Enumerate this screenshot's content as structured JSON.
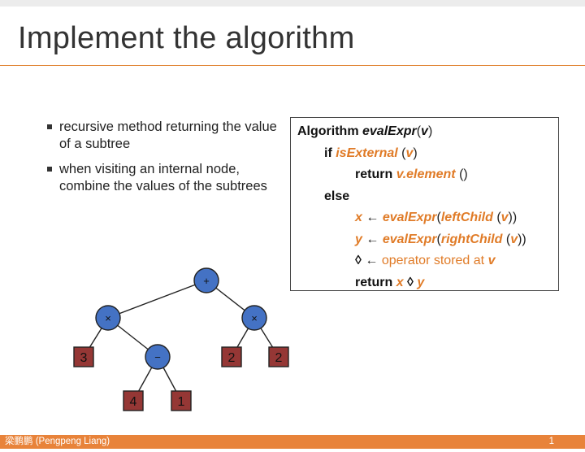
{
  "slide": {
    "title": "Implement the algorithm",
    "bullets": [
      "recursive method returning the value of a subtree",
      "when visiting an internal node, combine the values of the subtrees"
    ]
  },
  "algorithm": {
    "l1_kw": "Algorithm",
    "l1_name": "evalExpr",
    "l1_open": "(",
    "l1_arg": "v",
    "l1_close": ")",
    "l2_kw": "if",
    "l2_fn": "isExternal",
    "l2_open": "(",
    "l2_arg": "v",
    "l2_close": ")",
    "l3_kw": "return",
    "l3_expr": "v.element",
    "l3_paren": "()",
    "l4_kw": "else",
    "l5_var": "x",
    "l5_arrow": "←",
    "l5_fn": "evalExpr",
    "l5_open": "(",
    "l5_inner": "leftChild",
    "l5_paren_open": "(",
    "l5_arg": "v",
    "l5_paren_close": "))",
    "l6_var": "y",
    "l6_arrow": "←",
    "l6_fn": "evalExpr",
    "l6_open": "(",
    "l6_inner": "rightChild",
    "l6_paren_open": "(",
    "l6_arg": "v",
    "l6_paren_close": "))",
    "l7_sym": "◊",
    "l7_arrow": "←",
    "l7_text": "operator stored at",
    "l7_var": "v",
    "l8_kw": "return",
    "l8_x": "x",
    "l8_sym": "◊",
    "l8_y": "y"
  },
  "tree": {
    "nodes": {
      "root": "+",
      "left": "×",
      "right": "×",
      "minus": "−",
      "leaf_3": "3",
      "leaf_4": "4",
      "leaf_1": "1",
      "leaf_2a": "2",
      "leaf_2b": "2"
    },
    "colors": {
      "internal": "#4472c4",
      "external": "#953735"
    }
  },
  "footer": {
    "author": "梁鹏鹏 (Pengpeng Liang)",
    "page": "1"
  },
  "colors": {
    "accent": "#e8833a",
    "keyword_orange": "#e07b27"
  }
}
